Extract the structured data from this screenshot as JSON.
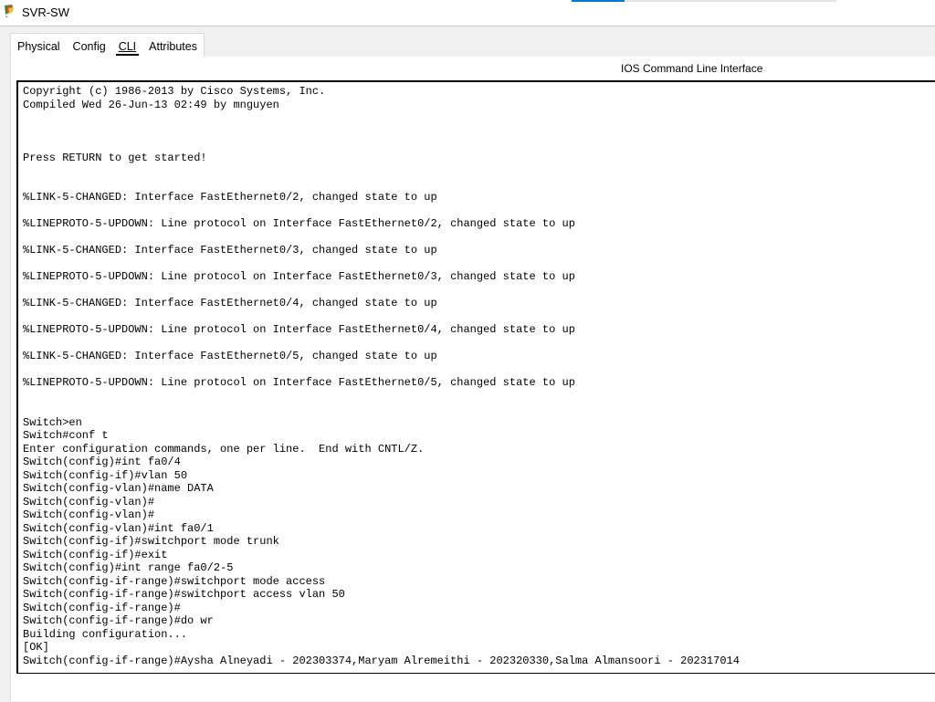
{
  "window": {
    "title": "SVR-SW",
    "icon": "packet-tracer-switch-icon"
  },
  "tabs": [
    {
      "label": "Physical",
      "active": false
    },
    {
      "label": "Config",
      "active": false
    },
    {
      "label": "CLI",
      "active": true
    },
    {
      "label": "Attributes",
      "active": false
    }
  ],
  "panel": {
    "title": "IOS Command Line Interface"
  },
  "cli": {
    "output": "Copyright (c) 1986-2013 by Cisco Systems, Inc.\nCompiled Wed 26-Jun-13 02:49 by mnguyen\n\n\n\nPress RETURN to get started!\n\n\n%LINK-5-CHANGED: Interface FastEthernet0/2, changed state to up\n\n%LINEPROTO-5-UPDOWN: Line protocol on Interface FastEthernet0/2, changed state to up\n\n%LINK-5-CHANGED: Interface FastEthernet0/3, changed state to up\n\n%LINEPROTO-5-UPDOWN: Line protocol on Interface FastEthernet0/3, changed state to up\n\n%LINK-5-CHANGED: Interface FastEthernet0/4, changed state to up\n\n%LINEPROTO-5-UPDOWN: Line protocol on Interface FastEthernet0/4, changed state to up\n\n%LINK-5-CHANGED: Interface FastEthernet0/5, changed state to up\n\n%LINEPROTO-5-UPDOWN: Line protocol on Interface FastEthernet0/5, changed state to up\n\n\nSwitch>en\nSwitch#conf t\nEnter configuration commands, one per line.  End with CNTL/Z.\nSwitch(config)#int fa0/4\nSwitch(config-if)#vlan 50\nSwitch(config-vlan)#name DATA\nSwitch(config-vlan)#\nSwitch(config-vlan)#\nSwitch(config-vlan)#int fa0/1\nSwitch(config-if)#switchport mode trunk\nSwitch(config-if)#exit\nSwitch(config)#int range fa0/2-5\nSwitch(config-if-range)#switchport mode access\nSwitch(config-if-range)#switchport access vlan 50\nSwitch(config-if-range)#\nSwitch(config-if-range)#do wr\nBuilding configuration...\n[OK]\nSwitch(config-if-range)#Aysha Alneyadi - 202303374,Maryam Alremeithi - 202320330,Salma Almansoori - 202317014"
  }
}
